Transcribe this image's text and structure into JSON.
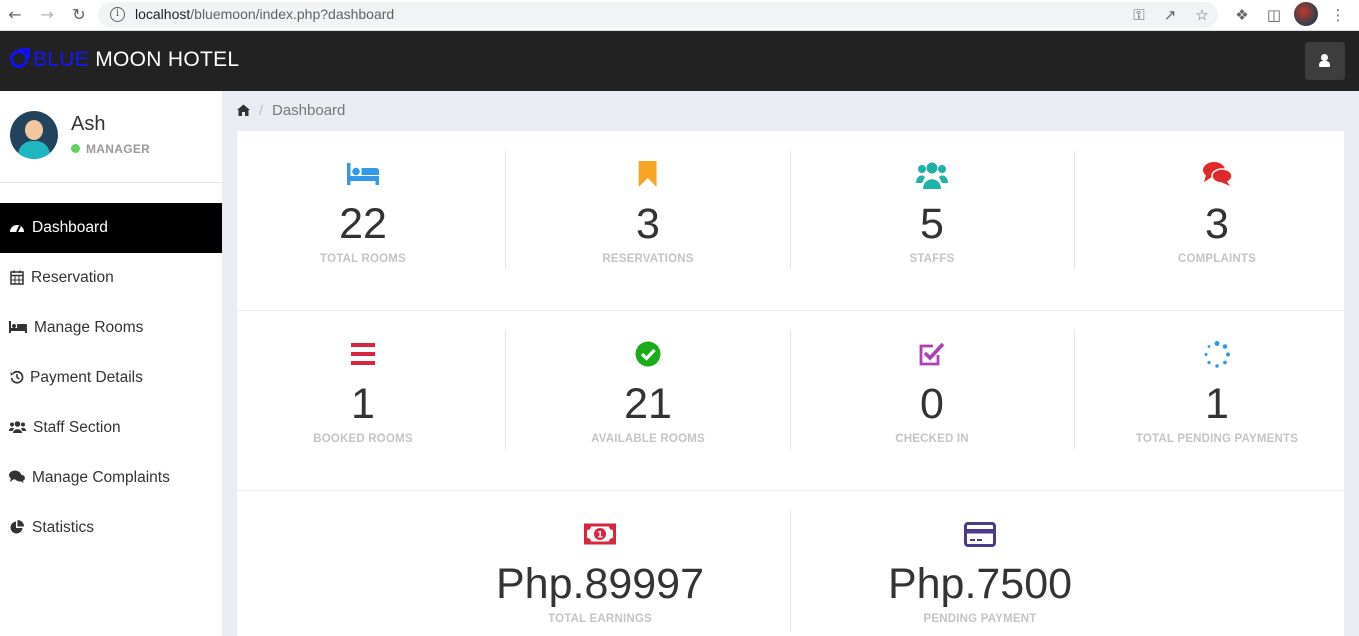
{
  "browser": {
    "url_host": "localhost",
    "url_path": "/bluemoon/index.php?dashboard"
  },
  "app": {
    "brand_blue": "BLUE",
    "brand_white": "MOON HOTEL"
  },
  "profile": {
    "name": "Ash",
    "role": "MANAGER"
  },
  "sidebar": {
    "items": [
      {
        "label": "Dashboard",
        "icon": "dashboard-icon",
        "active": true
      },
      {
        "label": "Reservation",
        "icon": "calendar-icon",
        "active": false
      },
      {
        "label": "Manage Rooms",
        "icon": "bed-icon",
        "active": false
      },
      {
        "label": "Payment Details",
        "icon": "history-icon",
        "active": false
      },
      {
        "label": "Staff Section",
        "icon": "users-icon",
        "active": false
      },
      {
        "label": "Manage Complaints",
        "icon": "comments-icon",
        "active": false
      },
      {
        "label": "Statistics",
        "icon": "pie-chart-icon",
        "active": false
      }
    ]
  },
  "breadcrumb": {
    "current": "Dashboard",
    "separator": "/"
  },
  "stats_row1": [
    {
      "value": "22",
      "label": "TOTAL ROOMS",
      "icon": "bed-icon",
      "color": "#3399e6"
    },
    {
      "value": "3",
      "label": "RESERVATIONS",
      "icon": "bookmark-icon",
      "color": "#f6a623"
    },
    {
      "value": "5",
      "label": "STAFFS",
      "icon": "users-icon",
      "color": "#1fb3a8"
    },
    {
      "value": "3",
      "label": "COMPLAINTS",
      "icon": "comments-icon",
      "color": "#e02a2a"
    }
  ],
  "stats_row2": [
    {
      "value": "1",
      "label": "BOOKED ROOMS",
      "icon": "bars-icon",
      "color": "#d9263f"
    },
    {
      "value": "21",
      "label": "AVAILABLE ROOMS",
      "icon": "check-circle-icon",
      "color": "#1aaa1a"
    },
    {
      "value": "0",
      "label": "CHECKED IN",
      "icon": "check-square-icon",
      "color": "#b03fb5"
    },
    {
      "value": "1",
      "label": "TOTAL PENDING PAYMENTS",
      "icon": "spinner-icon",
      "color": "#3399e6"
    }
  ],
  "stats_row3": [
    {
      "value": "Php.89997",
      "label": "TOTAL EARNINGS",
      "icon": "money-icon",
      "color": "#d9263f"
    },
    {
      "value": "Php.7500",
      "label": "PENDING PAYMENT",
      "icon": "credit-card-icon",
      "color": "#4b3a8c"
    }
  ]
}
